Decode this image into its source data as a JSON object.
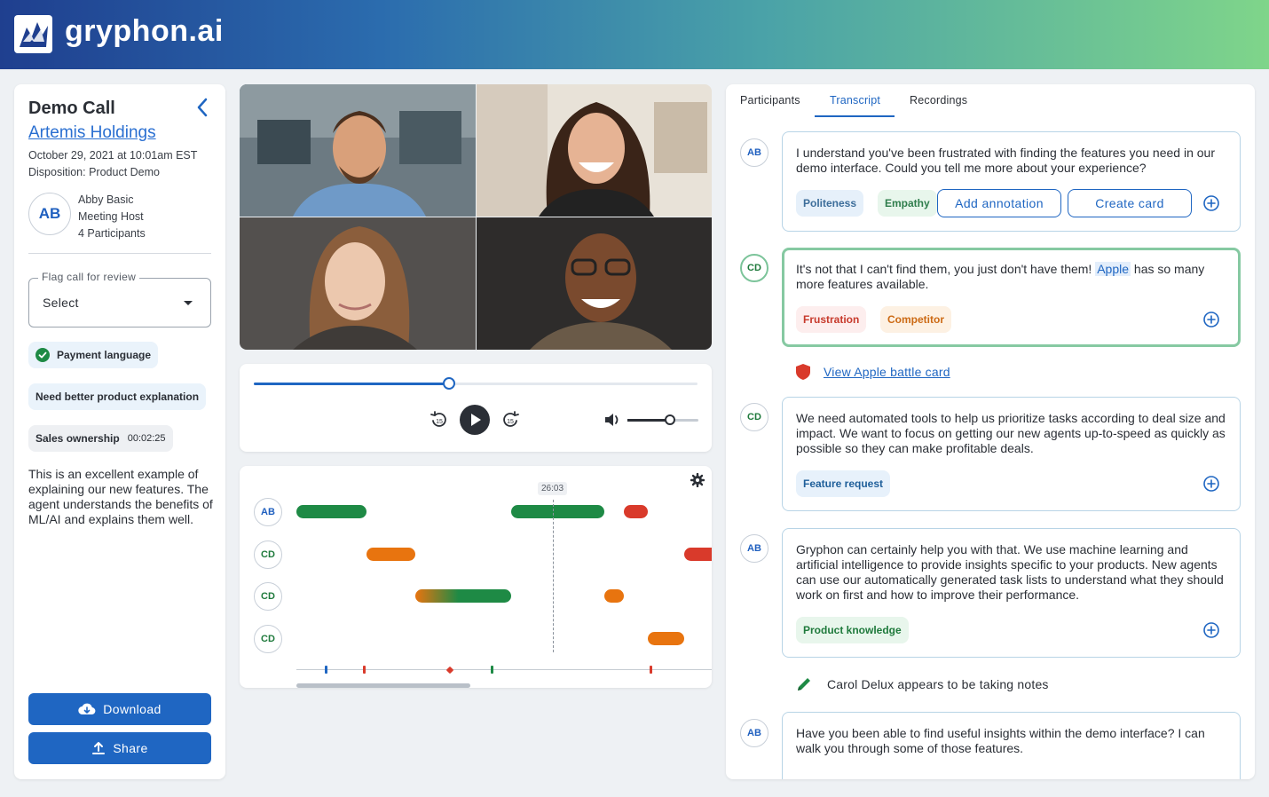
{
  "app": {
    "logo_text": "gryphon.ai"
  },
  "call": {
    "title": "Demo Call",
    "company": "Artemis Holdings",
    "date": "October 29, 2021 at 10:01am EST",
    "disposition": "Disposition: Product Demo",
    "host_initials": "AB",
    "host_name": "Abby Basic",
    "host_role": "Meeting Host",
    "participants": "4 Participants"
  },
  "flag": {
    "label": "Flag call for review",
    "value": "Select"
  },
  "chips": {
    "payment": "Payment language",
    "need": "Need better product explanation",
    "sales": "Sales ownership",
    "sales_time": "00:02:25"
  },
  "note": "This is an excellent example of explaining our new features. The agent understands the benefits of ML/AI and explains them well.",
  "buttons": {
    "download": "Download",
    "share": "Share"
  },
  "player": {
    "progress": 0.44,
    "volume": 0.6,
    "skip_back": "15",
    "skip_fwd": "15"
  },
  "timeline": {
    "current_time": "26:03",
    "speakers": [
      "AB",
      "CD",
      "CD",
      "CD"
    ],
    "colors": {
      "green": "#1e8a45",
      "red": "#d93a2b",
      "orange": "#e8740f"
    }
  },
  "tabs": {
    "participants": "Participants",
    "transcript": "Transcript",
    "recordings": "Recordings"
  },
  "transcript": {
    "m1": {
      "speaker": "AB",
      "text": "I understand you've been frustrated with finding the features you need in our demo interface. Could you tell me more about your experience?",
      "tag1": "Politeness",
      "tag2": "Empathy",
      "add_annotation": "Add annotation",
      "create_card": "Create card"
    },
    "m2": {
      "speaker": "CD",
      "text_before": "It's not that I can't find them, you just don't have them! ",
      "highlight": "Apple",
      "text_after": " has so many more features available.",
      "tag1": "Frustration",
      "tag2": "Competitor"
    },
    "battle_card": "View Apple battle card",
    "m3": {
      "speaker": "CD",
      "text": "We need automated tools to help us prioritize tasks according to deal size and impact. We want to focus on getting our new agents up-to-speed as quickly as possible so they can make profitable deals.",
      "tag1": "Feature request"
    },
    "m4": {
      "speaker": "AB",
      "text": "Gryphon can certainly help you with that. We use machine learning and artificial intelligence to provide insights specific to your products. New agents can use our automatically generated task lists to understand what they should work on first and how to improve their performance.",
      "tag1": "Product knowledge"
    },
    "notes_event": "Carol Delux appears to be taking notes",
    "m5": {
      "speaker": "AB",
      "text": "Have you been able to find useful insights within the demo interface? I can walk you through some of those features."
    }
  }
}
